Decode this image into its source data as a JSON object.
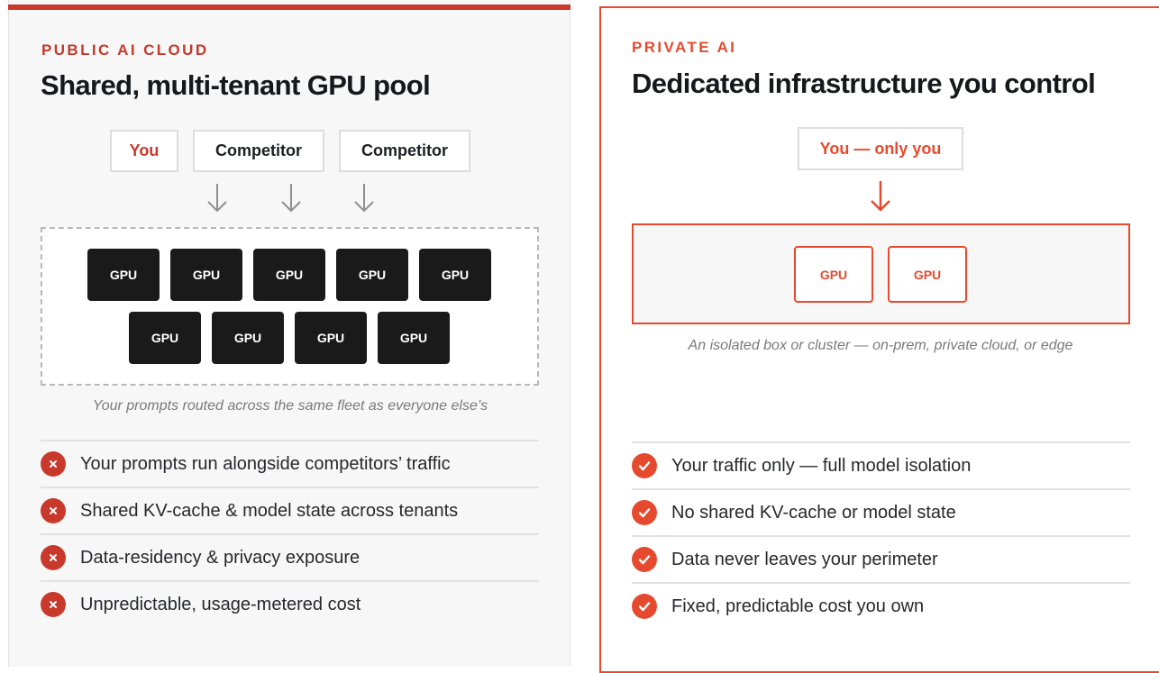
{
  "public_panel": {
    "eyebrow": "PUBLIC AI CLOUD",
    "title": "Shared, multi-tenant GPU pool",
    "tenants": [
      "You",
      "Competitor",
      "Competitor"
    ],
    "gpu_label": "GPU",
    "caption": "Your prompts routed across the same fleet as everyone else’s",
    "risks": [
      "Your prompts run alongside competitors’ traffic",
      "Shared KV-cache & model state across tenants",
      "Data-residency & privacy exposure",
      "Unpredictable, usage-metered cost"
    ],
    "risk_icon": "x-circle-icon"
  },
  "private_panel": {
    "eyebrow": "PRIVATE AI",
    "title": "Dedicated infrastructure you control",
    "tenant": "You — only you",
    "gpu_label": "GPU",
    "caption": "An isolated box or cluster — on-prem, private cloud, or edge",
    "benefits": [
      "Your traffic only — full model isolation",
      "No shared KV-cache or model state",
      "Data never leaves your perimeter",
      "Fixed, predictable cost you own"
    ],
    "benefit_icon": "check-circle-icon"
  },
  "colors": {
    "public_accent": "#c8392b",
    "private_accent": "#e64a2e",
    "gpu_dark": "#1a1a1a",
    "panel_bg": "#f7f7f7"
  }
}
